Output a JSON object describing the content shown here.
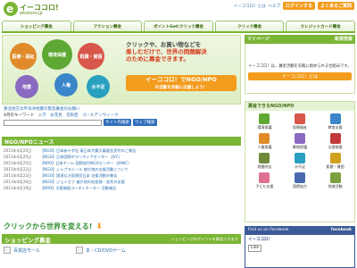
{
  "header": {
    "brand": "イーココロ!",
    "url": "ekokoro.jp",
    "links": [
      "イーココロ！とは",
      "ヘルプ"
    ],
    "signup_label": "ログインする",
    "faq_label": "よくあるご質問"
  },
  "nav": {
    "tabs": [
      "ショッピング募金",
      "アクション募金",
      "ポイントGet!クリック募金",
      "クリック募金",
      "クレジットカード募金"
    ]
  },
  "banner": {
    "bubbles": [
      "医療・福祉",
      "環境保護",
      "飢餓・貧困",
      "人権",
      "地雷",
      "水不足"
    ],
    "line1": "クリックや、お買い物などを",
    "line2": "楽しむだけで、世界の問題解決",
    "line3": "のために募金できます。",
    "cta": "イーココロ！でNGO/NPO",
    "cta_sub": "の活動を気軽に応援しよう！"
  },
  "middle": {
    "notice": "東北地方太平洋沖地震の緊急募金のお願い",
    "keyword_prefix": "4月のキーワード",
    "keywords": [
      "入学",
      "お花見",
      "花粉症",
      "ゴールデンウィーク"
    ],
    "search_btn": "サイト内検索",
    "web_btn": "ウェブ検索"
  },
  "news": {
    "title": "NGO/NPOニュース",
    "items": [
      {
        "date": "2011年4月25日",
        "text": "【NGO】日本赤十字社 東日本大震災義援金受付のご報告"
      },
      {
        "date": "2011年4月25日",
        "text": "【NGO】日本国際ボランティアセンター（JVC）"
      },
      {
        "date": "2011年4月25日",
        "text": "【NPO】日本チーム 国際協力NGOセンター（JANIC）"
      },
      {
        "date": "2011年4月22日",
        "text": "【NGO】シャプラニール 被災地の支援活動について"
      },
      {
        "date": "2011年4月22日",
        "text": "【NGO】国境なき医師団日本 支援活動の報告"
      },
      {
        "date": "2011年4月20日",
        "text": "【NGO】ジョイセフ 被災地の妊産婦・女性の支援"
      },
      {
        "date": "2011年4月19日",
        "text": "【NPO】災害救援コーディネーター 活動報告"
      }
    ]
  },
  "click_banner": {
    "text": "クリックから世界を変える!"
  },
  "shopping": {
    "title": "ショッピング募金",
    "sub": "ショッピングのポイントを募金できます",
    "items": [
      "百貨店モール",
      "本・CD/DVDゲーム"
    ]
  },
  "mypage": {
    "title": "マイページ",
    "register": "新規登録",
    "desc": "イーココロ！は、募金活動を気軽に始められる仕組みです。",
    "btn": "イーココロ！とは"
  },
  "orgs": {
    "title": "募金できるNGO/NPO",
    "list": [
      {
        "name": "環境保護",
        "color": "#5ea833"
      },
      {
        "name": "医療福祉",
        "color": "#d8564a"
      },
      {
        "name": "教育支援",
        "color": "#3a86c8"
      },
      {
        "name": "人権保護",
        "color": "#e08a2a"
      },
      {
        "name": "動物保護",
        "color": "#8a6ac0"
      },
      {
        "name": "災害救援",
        "color": "#c03a3a"
      },
      {
        "name": "地雷除去",
        "color": "#6e8a3a"
      },
      {
        "name": "水不足",
        "color": "#2aa0c0"
      },
      {
        "name": "飢餓・貧困",
        "color": "#d0a020"
      },
      {
        "name": "子ども支援",
        "color": "#e07090"
      },
      {
        "name": "国際協力",
        "color": "#4a6ab0"
      },
      {
        "name": "地域活動",
        "color": "#7aa040"
      }
    ]
  },
  "facebook": {
    "title": "Find us on Facebook",
    "brand": "facebook",
    "page": "イーココロ！",
    "like": "Like"
  }
}
